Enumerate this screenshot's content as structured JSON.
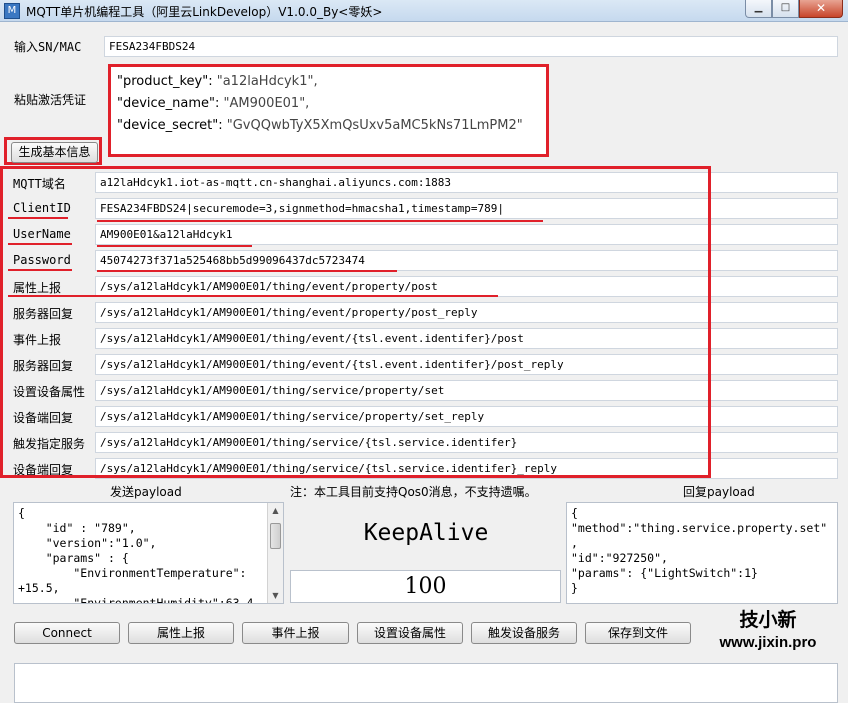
{
  "window": {
    "title": "MQTT单片机编程工具（阿里云LinkDevelop）V1.0.0_By<零妖>",
    "icon": "app-icon"
  },
  "form": {
    "sn_label": "输入SN/MAC",
    "sn_value": "FESA234FBDS24",
    "credential_label": "粘贴激活凭证",
    "credential_lines": [
      {
        "key": "\"product_key\"",
        "value": "\"a12laHdcyk1\","
      },
      {
        "key": "\"device_name\"",
        "value": "\"AM900E01\","
      },
      {
        "key": "\"device_secret\"",
        "value": "\"GvQQwbTyX5XmQsUxv5aMC5kNs71LmPM2\""
      }
    ],
    "generate_button": "生成基本信息"
  },
  "fields": [
    {
      "label": "MQTT域名",
      "value": "a12laHdcyk1.iot-as-mqtt.cn-shanghai.aliyuncs.com:1883"
    },
    {
      "label": "ClientID",
      "value": "FESA234FBDS24|securemode=3,signmethod=hmacsha1,timestamp=789|"
    },
    {
      "label": "UserName",
      "value": "AM900E01&a12laHdcyk1"
    },
    {
      "label": "Password",
      "value": "45074273f371a525468bb5d99096437dc5723474"
    },
    {
      "label": "属性上报",
      "value": "/sys/a12laHdcyk1/AM900E01/thing/event/property/post"
    },
    {
      "label": "服务器回复",
      "value": "/sys/a12laHdcyk1/AM900E01/thing/event/property/post_reply"
    },
    {
      "label": "事件上报",
      "value": "/sys/a12laHdcyk1/AM900E01/thing/event/{tsl.event.identifer}/post"
    },
    {
      "label": "服务器回复",
      "value": "/sys/a12laHdcyk1/AM900E01/thing/event/{tsl.event.identifer}/post_reply"
    },
    {
      "label": "设置设备属性",
      "value": "/sys/a12laHdcyk1/AM900E01/thing/service/property/set"
    },
    {
      "label": "设备端回复",
      "value": "/sys/a12laHdcyk1/AM900E01/thing/service/property/set_reply"
    },
    {
      "label": "触发指定服务",
      "value": "/sys/a12laHdcyk1/AM900E01/thing/service/{tsl.service.identifer}"
    },
    {
      "label": "设备端回复",
      "value": "/sys/a12laHdcyk1/AM900E01/thing/service/{tsl.service.identifer}_reply"
    }
  ],
  "send_panel": {
    "title": "发送payload",
    "text": "{\n    \"id\" : \"789\",\n    \"version\":\"1.0\",\n    \"params\" : {\n        \"EnvironmentTemperature\":\n+15.5,\n        \"EnvironmentHumidity\":63.4"
  },
  "note": "注：本工具目前支持Qos0消息，不支持遗嘱。",
  "keepalive": {
    "label": "KeepAlive",
    "value": "100"
  },
  "reply_panel": {
    "title": "回复payload",
    "text": "{\n\"method\":\"thing.service.property.set\"\n,\n\"id\":\"927250\",\n\"params\": {\"LightSwitch\":1}\n}"
  },
  "buttons": {
    "connect": "Connect",
    "property_report": "属性上报",
    "event_report": "事件上报",
    "set_property": "设置设备属性",
    "trigger_service": "触发设备服务",
    "save_file": "保存到文件"
  },
  "brand": {
    "name": "技小新",
    "url": "www.jixin.pro"
  },
  "colors": {
    "highlight": "#e0202a"
  }
}
